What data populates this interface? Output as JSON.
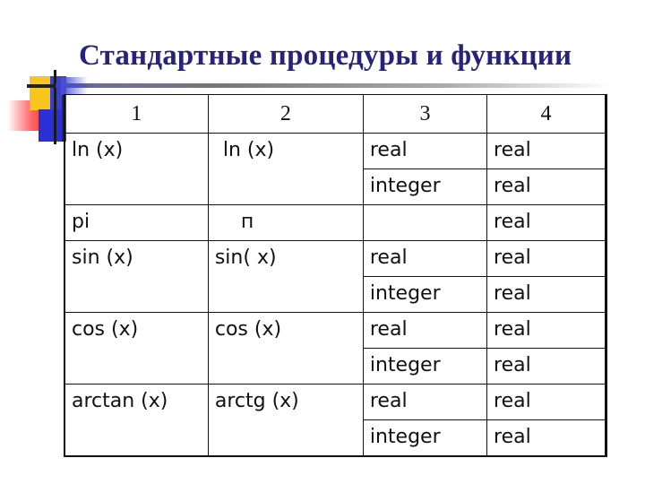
{
  "title": "Стандартные процедуры и функции",
  "table": {
    "headers": [
      "1",
      "2",
      "3",
      "4"
    ],
    "rows": [
      {
        "col1": "ln (x)",
        "col2": "ln (x)",
        "col3": [
          "real",
          "integer"
        ],
        "col4": [
          "real",
          "real"
        ]
      },
      {
        "col1": "pi",
        "col2": "п",
        "col3": [
          ""
        ],
        "col4": [
          "real"
        ]
      },
      {
        "col1": "sin (x)",
        "col2": "sin( x)",
        "col3": [
          "real",
          "integer"
        ],
        "col4": [
          "real",
          "real"
        ]
      },
      {
        "col1": "cos (x)",
        "col2": "cos (x)",
        "col3": [
          "real",
          "integer"
        ],
        "col4": [
          "real",
          "real"
        ]
      },
      {
        "col1": "arctan (x)",
        "col2": "arctg (x)",
        "col3": [
          "real",
          "integer"
        ],
        "col4": [
          "real",
          "real"
        ]
      }
    ]
  },
  "colors": {
    "title": "#27237a",
    "accent_yellow": "#f7c51d",
    "accent_blue": "#2b2fd6",
    "accent_red": "#f03a3a"
  }
}
